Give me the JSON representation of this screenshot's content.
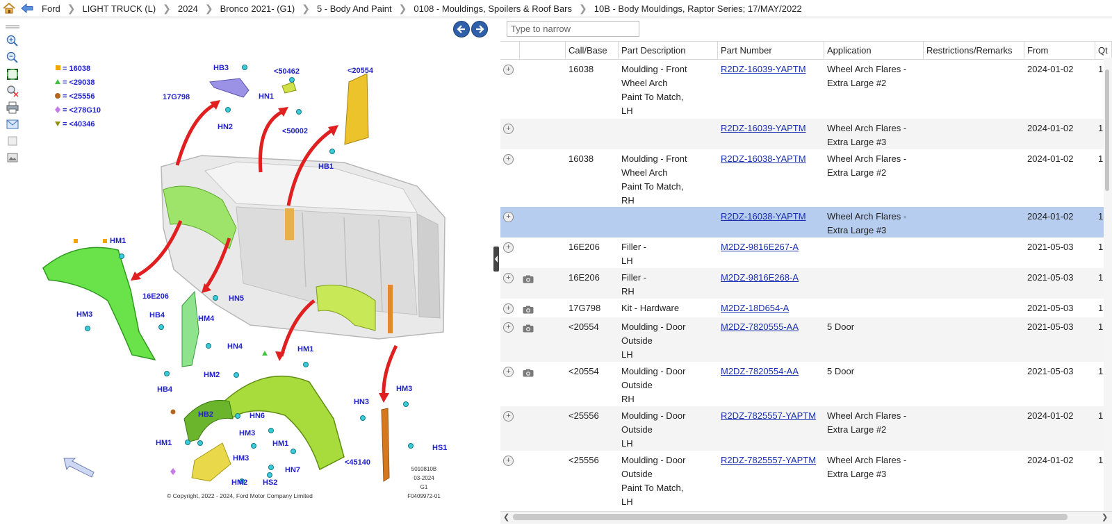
{
  "breadcrumb": {
    "items": [
      "Ford",
      "LIGHT TRUCK (L)",
      "2024",
      "Bronco 2021- (G1)",
      "5 - Body And Paint",
      "0108 - Mouldings, Spoilers & Roof Bars",
      "10B - Body Mouldings, Raptor Series; 17/MAY/2022"
    ]
  },
  "search": {
    "placeholder": "Type to narrow"
  },
  "legend": [
    "16038",
    "<29038",
    "<25556",
    "<278G10",
    "<40346"
  ],
  "callouts": {
    "hb3": "HB3",
    "n50462": "<50462",
    "n20554": "<20554",
    "n17g798": "17G798",
    "hn1": "HN1",
    "hn2": "HN2",
    "n50002": "<50002",
    "hb1": "HB1",
    "hm1a": "HM1",
    "n16e206": "16E206",
    "hn5": "HN5",
    "hb4a": "HB4",
    "hm4": "HM4",
    "hm3a": "HM3",
    "hn4": "HN4",
    "hm1b": "HM1",
    "hb4b": "HB4",
    "hm2a": "HM2",
    "hb2": "HB2",
    "hn6": "HN6",
    "hm3b": "HM3",
    "hm1c": "HM1",
    "hm1d": "HM1",
    "hm3c": "HM3",
    "hn7": "HN7",
    "hm2b": "HM2",
    "hs2": "HS2",
    "hn3": "HN3",
    "hm3d": "HM3",
    "hs1": "HS1",
    "n45140": "<45140"
  },
  "diagram_stamp": [
    "5010810B",
    "03-2024",
    "G1",
    "F0409972-01"
  ],
  "copyright": "© Copyright, 2022 - 2024, Ford Motor Company Limited",
  "colors": {
    "accent_blue": "#1a2fb0",
    "selected_row": "#b6cdf0",
    "callout_text": "#2222cc"
  },
  "table": {
    "columns": [
      "",
      "",
      "Call/Base",
      "Part Description",
      "Part Number",
      "Application",
      "Restrictions/Remarks",
      "From",
      "Qt"
    ],
    "rows": [
      {
        "camera": false,
        "call": "16038",
        "desc": "Moulding - Front\nWheel Arch\nPaint To Match,\nLH",
        "part": "R2DZ-16039-YAPTM",
        "app": "Wheel Arch Flares -\nExtra Large #2",
        "rest": "",
        "from": "2024-01-02",
        "qty": "1"
      },
      {
        "camera": false,
        "call": "",
        "desc": "",
        "part": "R2DZ-16039-YAPTM",
        "app": "Wheel Arch Flares -\nExtra Large #3",
        "rest": "",
        "from": "2024-01-02",
        "qty": "1"
      },
      {
        "camera": false,
        "call": "16038",
        "desc": "Moulding - Front\nWheel Arch\nPaint To Match,\nRH",
        "part": "R2DZ-16038-YAPTM",
        "app": "Wheel Arch Flares -\nExtra Large #2",
        "rest": "",
        "from": "2024-01-02",
        "qty": "1"
      },
      {
        "camera": false,
        "call": "",
        "desc": "",
        "part": "R2DZ-16038-YAPTM",
        "app": "Wheel Arch Flares -\nExtra Large #3",
        "rest": "",
        "from": "2024-01-02",
        "qty": "1"
      },
      {
        "camera": false,
        "call": "16E206",
        "desc": "Filler -\nLH",
        "part": "M2DZ-9816E267-A",
        "app": "",
        "rest": "",
        "from": "2021-05-03",
        "qty": "1"
      },
      {
        "camera": true,
        "call": "16E206",
        "desc": "Filler -\nRH",
        "part": "M2DZ-9816E268-A",
        "app": "",
        "rest": "",
        "from": "2021-05-03",
        "qty": "1"
      },
      {
        "camera": true,
        "call": "17G798",
        "desc": "Kit - Hardware",
        "part": "M2DZ-18D654-A",
        "app": "",
        "rest": "",
        "from": "2021-05-03",
        "qty": "1"
      },
      {
        "camera": true,
        "call": "<20554",
        "desc": "Moulding - Door\nOutside\nLH",
        "part": "M2DZ-7820555-AA",
        "app": "5 Door",
        "rest": "",
        "from": "2021-05-03",
        "qty": "1"
      },
      {
        "camera": true,
        "call": "<20554",
        "desc": "Moulding - Door\nOutside\nRH",
        "part": "M2DZ-7820554-AA",
        "app": "5 Door",
        "rest": "",
        "from": "2021-05-03",
        "qty": "1"
      },
      {
        "camera": false,
        "call": "<25556",
        "desc": "Moulding - Door\nOutside\nLH",
        "part": "R2DZ-7825557-YAPTM",
        "app": "Wheel Arch Flares -\nExtra Large #2",
        "rest": "",
        "from": "2024-01-02",
        "qty": "1"
      },
      {
        "camera": false,
        "call": "<25556",
        "desc": "Moulding - Door\nOutside\nPaint To Match,\nLH",
        "part": "R2DZ-7825557-YAPTM",
        "app": "Wheel Arch Flares -\nExtra Large #3",
        "rest": "",
        "from": "2024-01-02",
        "qty": "1"
      }
    ]
  }
}
